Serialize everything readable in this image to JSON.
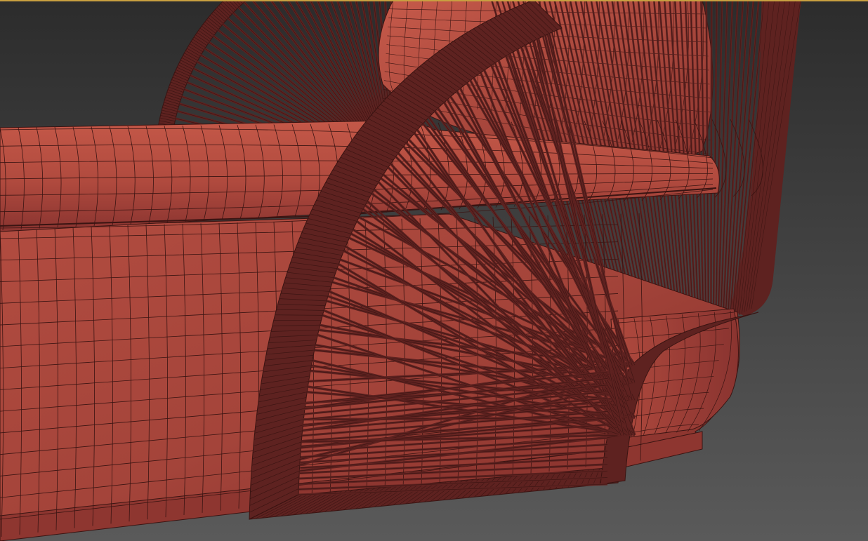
{
  "viewport": {
    "colors": {
      "background_top": "#2c2c2c",
      "background_bottom": "#5a5a5a",
      "frame_border": "#c8a040",
      "mesh_light": "#c45848",
      "mesh_mid": "#a8403a",
      "mesh_dark": "#7e2c28",
      "wire": "#3a1412",
      "rope": "#5e2220"
    },
    "objects": {
      "sofa_body": "sofa-body",
      "bolster_armrest": "bolster-armrest",
      "back_cushion": "back-cushion",
      "rope_armrest_front": "rope-armrest-front",
      "rope_armrest_back": "rope-armrest-back",
      "rope_backrest": "rope-backrest"
    }
  }
}
